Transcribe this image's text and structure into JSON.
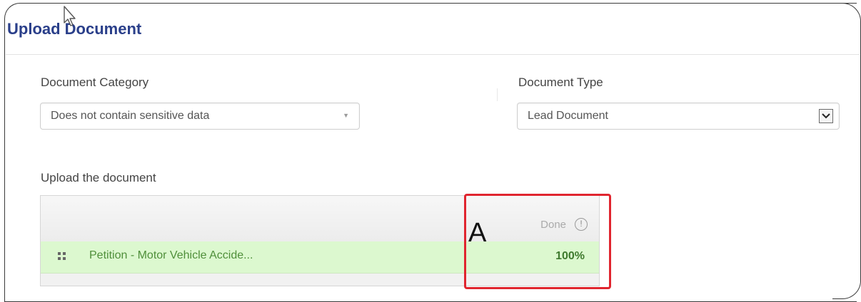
{
  "title": "Upload Document",
  "document_category": {
    "label": "Document Category",
    "value": "Does not contain sensitive data"
  },
  "document_type": {
    "label": "Document Type",
    "value": "Lead Document"
  },
  "upload": {
    "label": "Upload the document",
    "status_header": "Done",
    "file_name": "Petition - Motor Vehicle Accide...",
    "progress_text": "100%",
    "progress": 1.0
  },
  "annotation": {
    "marker": "A",
    "highlight_color": "#e0252f"
  },
  "colors": {
    "title": "#2a3f8a",
    "file_row": "#dcf8cf",
    "file_text": "#4f8f3a"
  },
  "icons": [
    "mouse-cursor-icon",
    "chevron-down-icon",
    "info-circle-icon",
    "drag-handle-icon"
  ]
}
